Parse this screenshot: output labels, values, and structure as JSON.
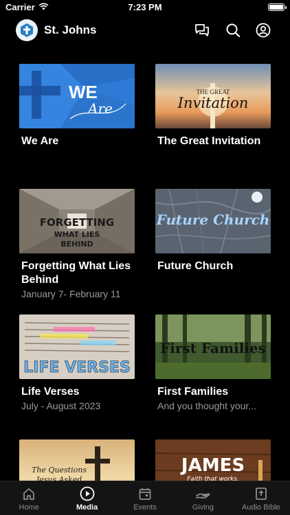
{
  "status": {
    "carrier": "Carrier",
    "time": "7:23 PM"
  },
  "header": {
    "title": "St. Johns"
  },
  "cards": [
    {
      "title": "We Are",
      "subtitle": "",
      "thumb_text": "WE Are"
    },
    {
      "title": "The Great Invitation",
      "subtitle": "",
      "thumb_text": "THE GREAT Invitation"
    },
    {
      "title": "Forgetting What Lies Behind",
      "subtitle": "January 7- February 11",
      "thumb_text": "FORGETTING WHAT LIES BEHIND"
    },
    {
      "title": "Future Church",
      "subtitle": "",
      "thumb_text": "Future Church"
    },
    {
      "title": "Life Verses",
      "subtitle": "July - August 2023",
      "thumb_text": "LIFE VERSES"
    },
    {
      "title": "First Families",
      "subtitle": "And you thought your...",
      "thumb_text": "First Families"
    },
    {
      "title": "",
      "subtitle": "",
      "thumb_text": "The Questions Jesus Asked"
    },
    {
      "title": "",
      "subtitle": "",
      "thumb_text": "JAMES",
      "thumb_subtext": "Faith that works."
    }
  ],
  "tabs": [
    {
      "label": "Home",
      "icon": "home-icon",
      "active": false
    },
    {
      "label": "Media",
      "icon": "play-circle-icon",
      "active": true
    },
    {
      "label": "Events",
      "icon": "calendar-icon",
      "active": false
    },
    {
      "label": "Giving",
      "icon": "giving-hand-icon",
      "active": false
    },
    {
      "label": "Audio Bible",
      "icon": "bible-icon",
      "active": false
    }
  ]
}
